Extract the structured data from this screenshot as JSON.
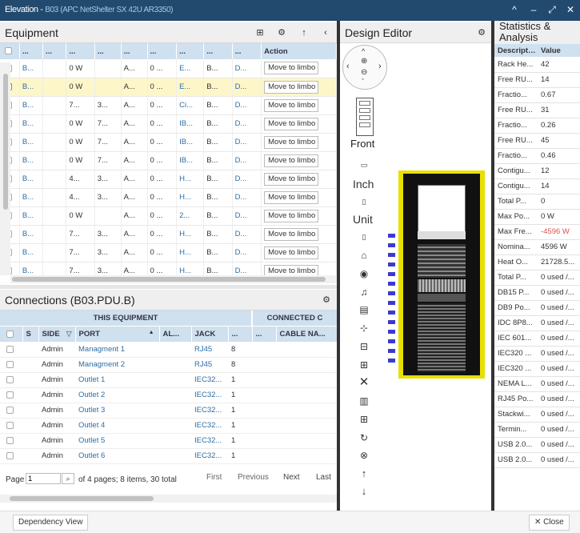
{
  "window": {
    "title": "Elevation - ",
    "subtitle": "B03 (APC NetShelter SX 42U AR3350)",
    "buttons": [
      "^",
      "–",
      "⤢",
      "✕"
    ]
  },
  "equipment": {
    "title": "Equipment",
    "columns": [
      "...",
      "...",
      "...",
      "...",
      "...",
      "...",
      "...",
      "...",
      "...",
      "Action"
    ],
    "action_label": "Move to limbo",
    "rows": [
      {
        "c1": "B...",
        "c2": "",
        "c3": "0 W",
        "c4": "",
        "c5": "A...",
        "c6": "0 ...",
        "c7": "E...",
        "c8": "B...",
        "c9": "D...",
        "checked": false,
        "selected": false
      },
      {
        "c1": "B...",
        "c2": "",
        "c3": "0 W",
        "c4": "",
        "c5": "A...",
        "c6": "0 ...",
        "c7": "E...",
        "c8": "B...",
        "c9": "D...",
        "checked": true,
        "selected": true
      },
      {
        "c1": "B...",
        "c2": "",
        "c3": "7...",
        "c4": "3...",
        "c5": "A...",
        "c6": "0 ...",
        "c7": "Ci...",
        "c8": "B...",
        "c9": "D...",
        "checked": false,
        "selected": false
      },
      {
        "c1": "B...",
        "c2": "",
        "c3": "0 W",
        "c4": "7...",
        "c5": "A...",
        "c6": "0 ...",
        "c7": "IB...",
        "c8": "B...",
        "c9": "D...",
        "checked": false,
        "selected": false
      },
      {
        "c1": "B...",
        "c2": "",
        "c3": "0 W",
        "c4": "7...",
        "c5": "A...",
        "c6": "0 ...",
        "c7": "IB...",
        "c8": "B...",
        "c9": "D...",
        "checked": false,
        "selected": false
      },
      {
        "c1": "B...",
        "c2": "",
        "c3": "0 W",
        "c4": "7...",
        "c5": "A...",
        "c6": "0 ...",
        "c7": "IB...",
        "c8": "B...",
        "c9": "D...",
        "checked": false,
        "selected": false
      },
      {
        "c1": "B...",
        "c2": "",
        "c3": "4...",
        "c4": "3...",
        "c5": "A...",
        "c6": "0 ...",
        "c7": "H...",
        "c8": "B...",
        "c9": "D...",
        "checked": false,
        "selected": false
      },
      {
        "c1": "B...",
        "c2": "",
        "c3": "4...",
        "c4": "3...",
        "c5": "A...",
        "c6": "0 ...",
        "c7": "H...",
        "c8": "B...",
        "c9": "D...",
        "checked": false,
        "selected": false
      },
      {
        "c1": "B...",
        "c2": "",
        "c3": "0 W",
        "c4": "",
        "c5": "A...",
        "c6": "0 ...",
        "c7": "2...",
        "c8": "B...",
        "c9": "D...",
        "checked": false,
        "selected": false
      },
      {
        "c1": "B...",
        "c2": "",
        "c3": "7...",
        "c4": "3...",
        "c5": "A...",
        "c6": "0 ...",
        "c7": "H...",
        "c8": "B...",
        "c9": "D...",
        "checked": false,
        "selected": false
      },
      {
        "c1": "B...",
        "c2": "",
        "c3": "7...",
        "c4": "3...",
        "c5": "A...",
        "c6": "0 ...",
        "c7": "H...",
        "c8": "B...",
        "c9": "D...",
        "checked": false,
        "selected": false
      },
      {
        "c1": "B...",
        "c2": "",
        "c3": "7...",
        "c4": "3...",
        "c5": "A...",
        "c6": "0 ...",
        "c7": "H...",
        "c8": "B...",
        "c9": "D...",
        "checked": false,
        "selected": false
      }
    ]
  },
  "connections": {
    "title": "Connections (B03.PDU.B)",
    "group_this": "THIS EQUIPMENT",
    "group_connected": "CONNECTED C",
    "columns": [
      "S",
      "SIDE",
      "PORT",
      "AL...",
      "JACK",
      "...",
      "...",
      "CABLE NA..."
    ],
    "rows": [
      {
        "side": "Admin",
        "port": "Managment 1",
        "jack": "RJ45",
        "n": "8"
      },
      {
        "side": "Admin",
        "port": "Managment 2",
        "jack": "RJ45",
        "n": "8"
      },
      {
        "side": "Admin",
        "port": "Outlet 1",
        "jack": "IEC32...",
        "n": "1"
      },
      {
        "side": "Admin",
        "port": "Outlet 2",
        "jack": "IEC32...",
        "n": "1"
      },
      {
        "side": "Admin",
        "port": "Outlet 3",
        "jack": "IEC32...",
        "n": "1"
      },
      {
        "side": "Admin",
        "port": "Outlet 4",
        "jack": "IEC32...",
        "n": "1"
      },
      {
        "side": "Admin",
        "port": "Outlet 5",
        "jack": "IEC32...",
        "n": "1"
      },
      {
        "side": "Admin",
        "port": "Outlet 6",
        "jack": "IEC32...",
        "n": "1"
      }
    ],
    "pager": {
      "page_label": "Page",
      "page_value": "1",
      "summary": "of 4 pages; 8 items, 30 total",
      "first": "First",
      "previous": "Previous",
      "next": "Next",
      "last": "Last"
    }
  },
  "design_editor": {
    "title": "Design Editor",
    "front_label": "Front",
    "inch_label": "Inch",
    "unit_label": "Unit"
  },
  "statistics": {
    "title_line1": "Statistics &",
    "title_line2": "Analysis",
    "col_description": "Description",
    "col_value": "Value",
    "rows": [
      {
        "d": "Rack He...",
        "v": "42",
        "neg": false
      },
      {
        "d": "Free RU...",
        "v": "14",
        "neg": false
      },
      {
        "d": "Fractio...",
        "v": "0.67",
        "neg": false
      },
      {
        "d": "Free RU...",
        "v": "31",
        "neg": false
      },
      {
        "d": "Fractio...",
        "v": "0.26",
        "neg": false
      },
      {
        "d": "Free RU...",
        "v": "45",
        "neg": false
      },
      {
        "d": "Fractio...",
        "v": "0.46",
        "neg": false
      },
      {
        "d": "Contigu...",
        "v": "12",
        "neg": false
      },
      {
        "d": "Contigu...",
        "v": "14",
        "neg": false
      },
      {
        "d": "Total P...",
        "v": "0",
        "neg": false
      },
      {
        "d": "Max Po...",
        "v": "0 W",
        "neg": false
      },
      {
        "d": "Max Fre...",
        "v": "-4596 W",
        "neg": true
      },
      {
        "d": "Nomina...",
        "v": "4596 W",
        "neg": false
      },
      {
        "d": "Heat O...",
        "v": "21728.5...",
        "neg": false
      },
      {
        "d": "Total P...",
        "v": "0 used /...",
        "neg": false
      },
      {
        "d": "DB15 P...",
        "v": "0 used /...",
        "neg": false
      },
      {
        "d": "DB9 Po...",
        "v": "0 used /...",
        "neg": false
      },
      {
        "d": "IDC 8P8...",
        "v": "0 used /...",
        "neg": false
      },
      {
        "d": "IEC 601...",
        "v": "0 used /...",
        "neg": false
      },
      {
        "d": "IEC320 ...",
        "v": "0 used /...",
        "neg": false
      },
      {
        "d": "IEC320 ...",
        "v": "0 used /...",
        "neg": false
      },
      {
        "d": "NEMA L...",
        "v": "0 used /...",
        "neg": false
      },
      {
        "d": "RJ45 Po...",
        "v": "0 used /...",
        "neg": false
      },
      {
        "d": "Stackwi...",
        "v": "0 used /...",
        "neg": false
      },
      {
        "d": "Termin...",
        "v": "0 used /...",
        "neg": false
      },
      {
        "d": "USB 2.0...",
        "v": "0 used /...",
        "neg": false
      },
      {
        "d": "USB 2.0...",
        "v": "0 used /...",
        "neg": false
      }
    ]
  },
  "footer": {
    "dependency_view": "Dependency View",
    "close": "Close"
  },
  "colors": {
    "titlebar": "#214a6e",
    "header_blue": "#cfe0ef",
    "link": "#2e6da4",
    "rack_yellow": "#e8e000",
    "selected_row": "#fdf6c9"
  }
}
